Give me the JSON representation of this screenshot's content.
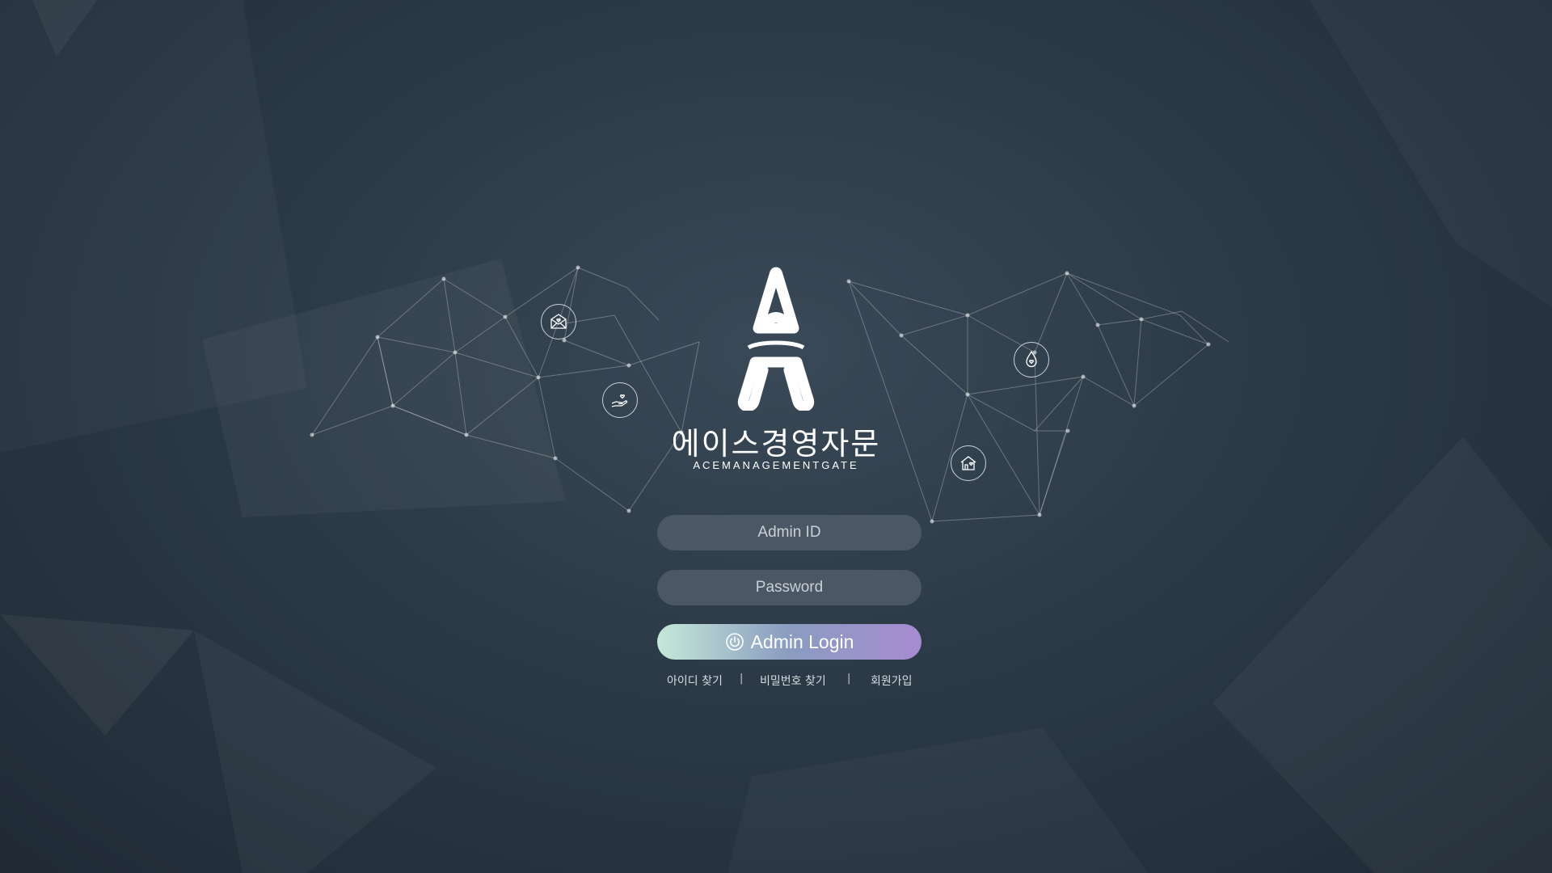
{
  "brand": {
    "name": "에이스경영자문",
    "subtitle": "ACEMANAGEMENTGATE"
  },
  "form": {
    "id_placeholder": "Admin ID",
    "password_placeholder": "Password",
    "login_label": "Admin Login"
  },
  "links": {
    "find_id": "아이디 찾기",
    "find_password": "비밀번호 찾기",
    "signup": "회원가입",
    "separator": "|"
  },
  "icons": {
    "mail": "mail-heart-icon",
    "hand": "hand-heart-icon",
    "drop": "drop-heart-icon",
    "house": "house-heart-icon",
    "power": "power-icon"
  },
  "colors": {
    "background": "#2c3a47",
    "field": "#505c68",
    "button_gradient_start": "#c5e8d8",
    "button_gradient_end": "#a78bd1"
  }
}
